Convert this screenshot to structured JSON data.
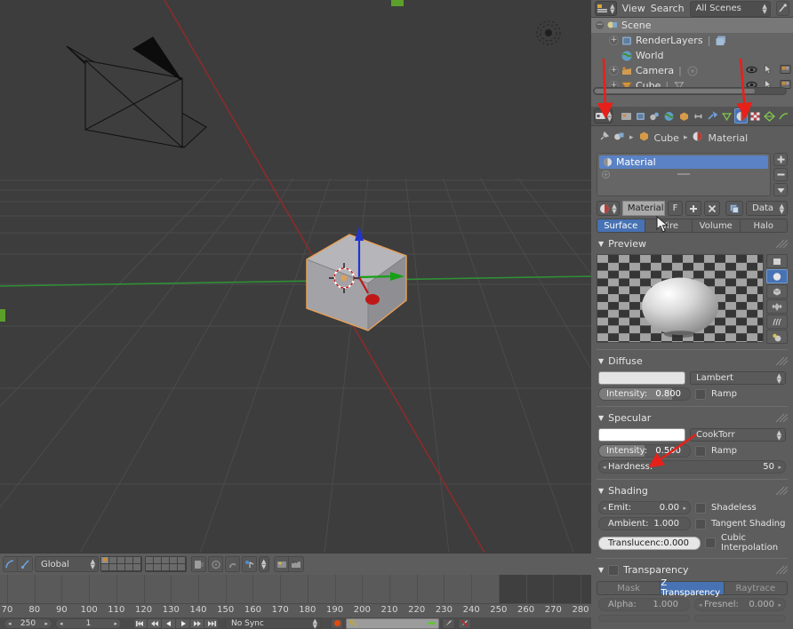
{
  "app": {
    "name": "Blender",
    "theme_bg": "#5d5d5d",
    "accent": "#4772b3",
    "select_orange": "#e8a159"
  },
  "viewport": {
    "objects": [
      "Camera",
      "Cube",
      "Lamp"
    ],
    "grid_on": true,
    "axis_x_color": "#9c2b2b",
    "axis_y_color": "#2f9c2f",
    "manipulator": "translate",
    "cursor_3d": true
  },
  "viewport_header": {
    "transform_orientation": "Global",
    "icons": [
      "editor-type-icon",
      "object-mode-icon",
      "viewport-shading-icon",
      "pivot-icon",
      "snap-magnet-icon",
      "manipulator-icon",
      "render-layer-icon",
      "render-animation-icon"
    ],
    "layers": {
      "rows": 2,
      "cols": 5,
      "blocks": 2,
      "active_layer": 1
    }
  },
  "timeline": {
    "start_label": "250",
    "current_frame": "1",
    "sync_mode": "No Sync",
    "record_enabled": true,
    "ticks": [
      70,
      80,
      90,
      100,
      110,
      120,
      130,
      140,
      150,
      160,
      170,
      180,
      190,
      200,
      210,
      220,
      230,
      240,
      250,
      260,
      270,
      280
    ],
    "range_end": 250,
    "playback_buttons": [
      "jump-to-start",
      "rewind",
      "play-reverse",
      "play",
      "fast-forward",
      "jump-to-end"
    ]
  },
  "outliner": {
    "header": {
      "editor_icon": "outliner-icon",
      "menus": [
        "View",
        "Search"
      ],
      "display_mode": "All Scenes",
      "filter_icon": "filter-icon"
    },
    "rows": [
      {
        "label": "Scene",
        "icon": "scene-icon",
        "indent": 0,
        "selected": true,
        "expander": "minus",
        "row_icons": []
      },
      {
        "label": "RenderLayers",
        "icon": "renderlayer-icon",
        "indent": 1,
        "selected": false,
        "expander": "plus",
        "row_icons": [
          "renderlayer-badge"
        ]
      },
      {
        "label": "World",
        "icon": "world-icon",
        "indent": 1,
        "selected": false,
        "expander": "none",
        "row_icons": []
      },
      {
        "label": "Camera",
        "icon": "camera-icon",
        "indent": 1,
        "selected": false,
        "expander": "plus",
        "row_icons": [
          "eye-icon",
          "cursor-icon",
          "render-icon"
        ]
      },
      {
        "label": "Cube",
        "icon": "mesh-icon",
        "indent": 1,
        "selected": false,
        "expander": "plus",
        "row_icons": [
          "eye-icon",
          "cursor-icon",
          "render-icon"
        ]
      }
    ]
  },
  "properties": {
    "context_tabs": [
      "render-icon",
      "scene-icon",
      "world-icon",
      "object-icon",
      "constraint-icon",
      "modifier-icon",
      "data-icon",
      "material-icon",
      "texture-icon",
      "physics-icon",
      "particles-icon"
    ],
    "active_tab": "material-icon",
    "editor_type_icon": "properties-icon",
    "breadcrumb": {
      "pin_icon": "pin-icon",
      "object_icon": "object-icon",
      "object": "Cube",
      "material_icon": "material-icon",
      "material": "Material"
    },
    "material_slots": {
      "items": [
        {
          "name": "Material",
          "active": true
        }
      ],
      "side_buttons": [
        "add-slot",
        "remove-slot",
        "slot-specials"
      ]
    },
    "datablock": {
      "browse_icon": "material-browse-icon",
      "name": "Material",
      "fake_user": "F",
      "new_icon": "plus-icon",
      "unlink_icon": "x-icon",
      "copy_icon": "copy-icon",
      "type": "Data"
    },
    "surface_tabs": [
      {
        "label": "Surface",
        "active": true
      },
      {
        "label": "Wire",
        "active": false
      },
      {
        "label": "Volume",
        "active": false
      },
      {
        "label": "Halo",
        "active": false
      }
    ],
    "panels": {
      "preview": {
        "title": "Preview",
        "types": [
          "flat-preview",
          "sphere-preview",
          "cube-preview",
          "monkey-preview",
          "hair-preview",
          "sphere-sky-preview"
        ],
        "active_type": "sphere-preview"
      },
      "diffuse": {
        "title": "Diffuse",
        "color": "#e4e4e4",
        "shader": "Lambert",
        "intensity_label": "Intensity:",
        "intensity_value": "0.800",
        "intensity_fraction": 0.8,
        "ramp_label": "Ramp",
        "ramp_checked": false
      },
      "specular": {
        "title": "Specular",
        "color": "#ffffff",
        "shader": "CookTorr",
        "intensity_label": "Intensity:",
        "intensity_value": "0.500",
        "intensity_fraction": 0.5,
        "ramp_label": "Ramp",
        "ramp_checked": false,
        "hardness_label": "Hardness:",
        "hardness_value": "50"
      },
      "shading": {
        "title": "Shading",
        "emit_label": "Emit:",
        "emit_value": "0.00",
        "ambient_label": "Ambient:",
        "ambient_value": "1.000",
        "translucency_label": "Translucenc:",
        "translucency_value": "0.000",
        "shadeless_label": "Shadeless",
        "tangent_label": "Tangent Shading",
        "cubic_label": "Cubic Interpolation"
      },
      "transparency": {
        "title": "Transparency",
        "enabled": false,
        "modes": [
          {
            "label": "Mask",
            "active": false
          },
          {
            "label": "Z Transparency",
            "active": true
          },
          {
            "label": "Raytrace",
            "active": false
          }
        ],
        "alpha_label": "Alpha:",
        "alpha_value": "1.000",
        "fresnel_label": "Fresnel:",
        "fresnel_value": "0.000"
      }
    }
  },
  "annotations": {
    "arrows": [
      {
        "name": "arrow-to-editor-type",
        "color": "#e8201a"
      },
      {
        "name": "arrow-to-material-tab",
        "color": "#e8201a"
      },
      {
        "name": "arrow-to-specular-intensity",
        "color": "#e8201a"
      }
    ]
  }
}
